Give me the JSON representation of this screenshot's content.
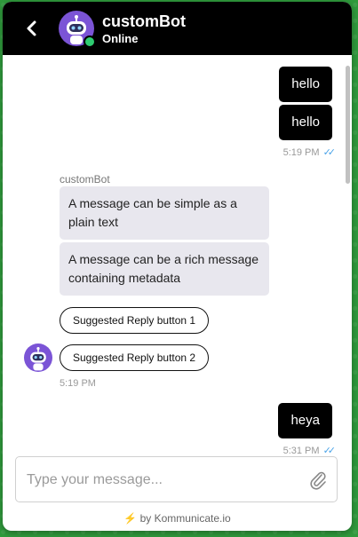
{
  "header": {
    "bot_name": "customBot",
    "status": "Online",
    "status_color": "#2ecc71",
    "avatar_color": "#7b54d6",
    "back_icon": "chevron-left-icon"
  },
  "conversation": {
    "outgoing_1": [
      "hello",
      "hello"
    ],
    "outgoing_1_time": "5:19 PM",
    "sender_label": "customBot",
    "incoming": [
      "A message can be simple as a plain text",
      "A message can be a rich message containing metadata"
    ],
    "suggested_replies": [
      "Suggested Reply button 1",
      "Suggested Reply button 2"
    ],
    "incoming_time": "5:19 PM",
    "outgoing_2": "heya",
    "outgoing_2_time": "5:31 PM",
    "read_tick_color": "#4aa3e8"
  },
  "composer": {
    "placeholder": "Type your message...",
    "attach_icon": "paperclip-icon"
  },
  "footer": {
    "powered_by": "by Kommunicate.io",
    "bolt_icon": "lightning-icon",
    "bolt_color": "#7b3fe4"
  }
}
